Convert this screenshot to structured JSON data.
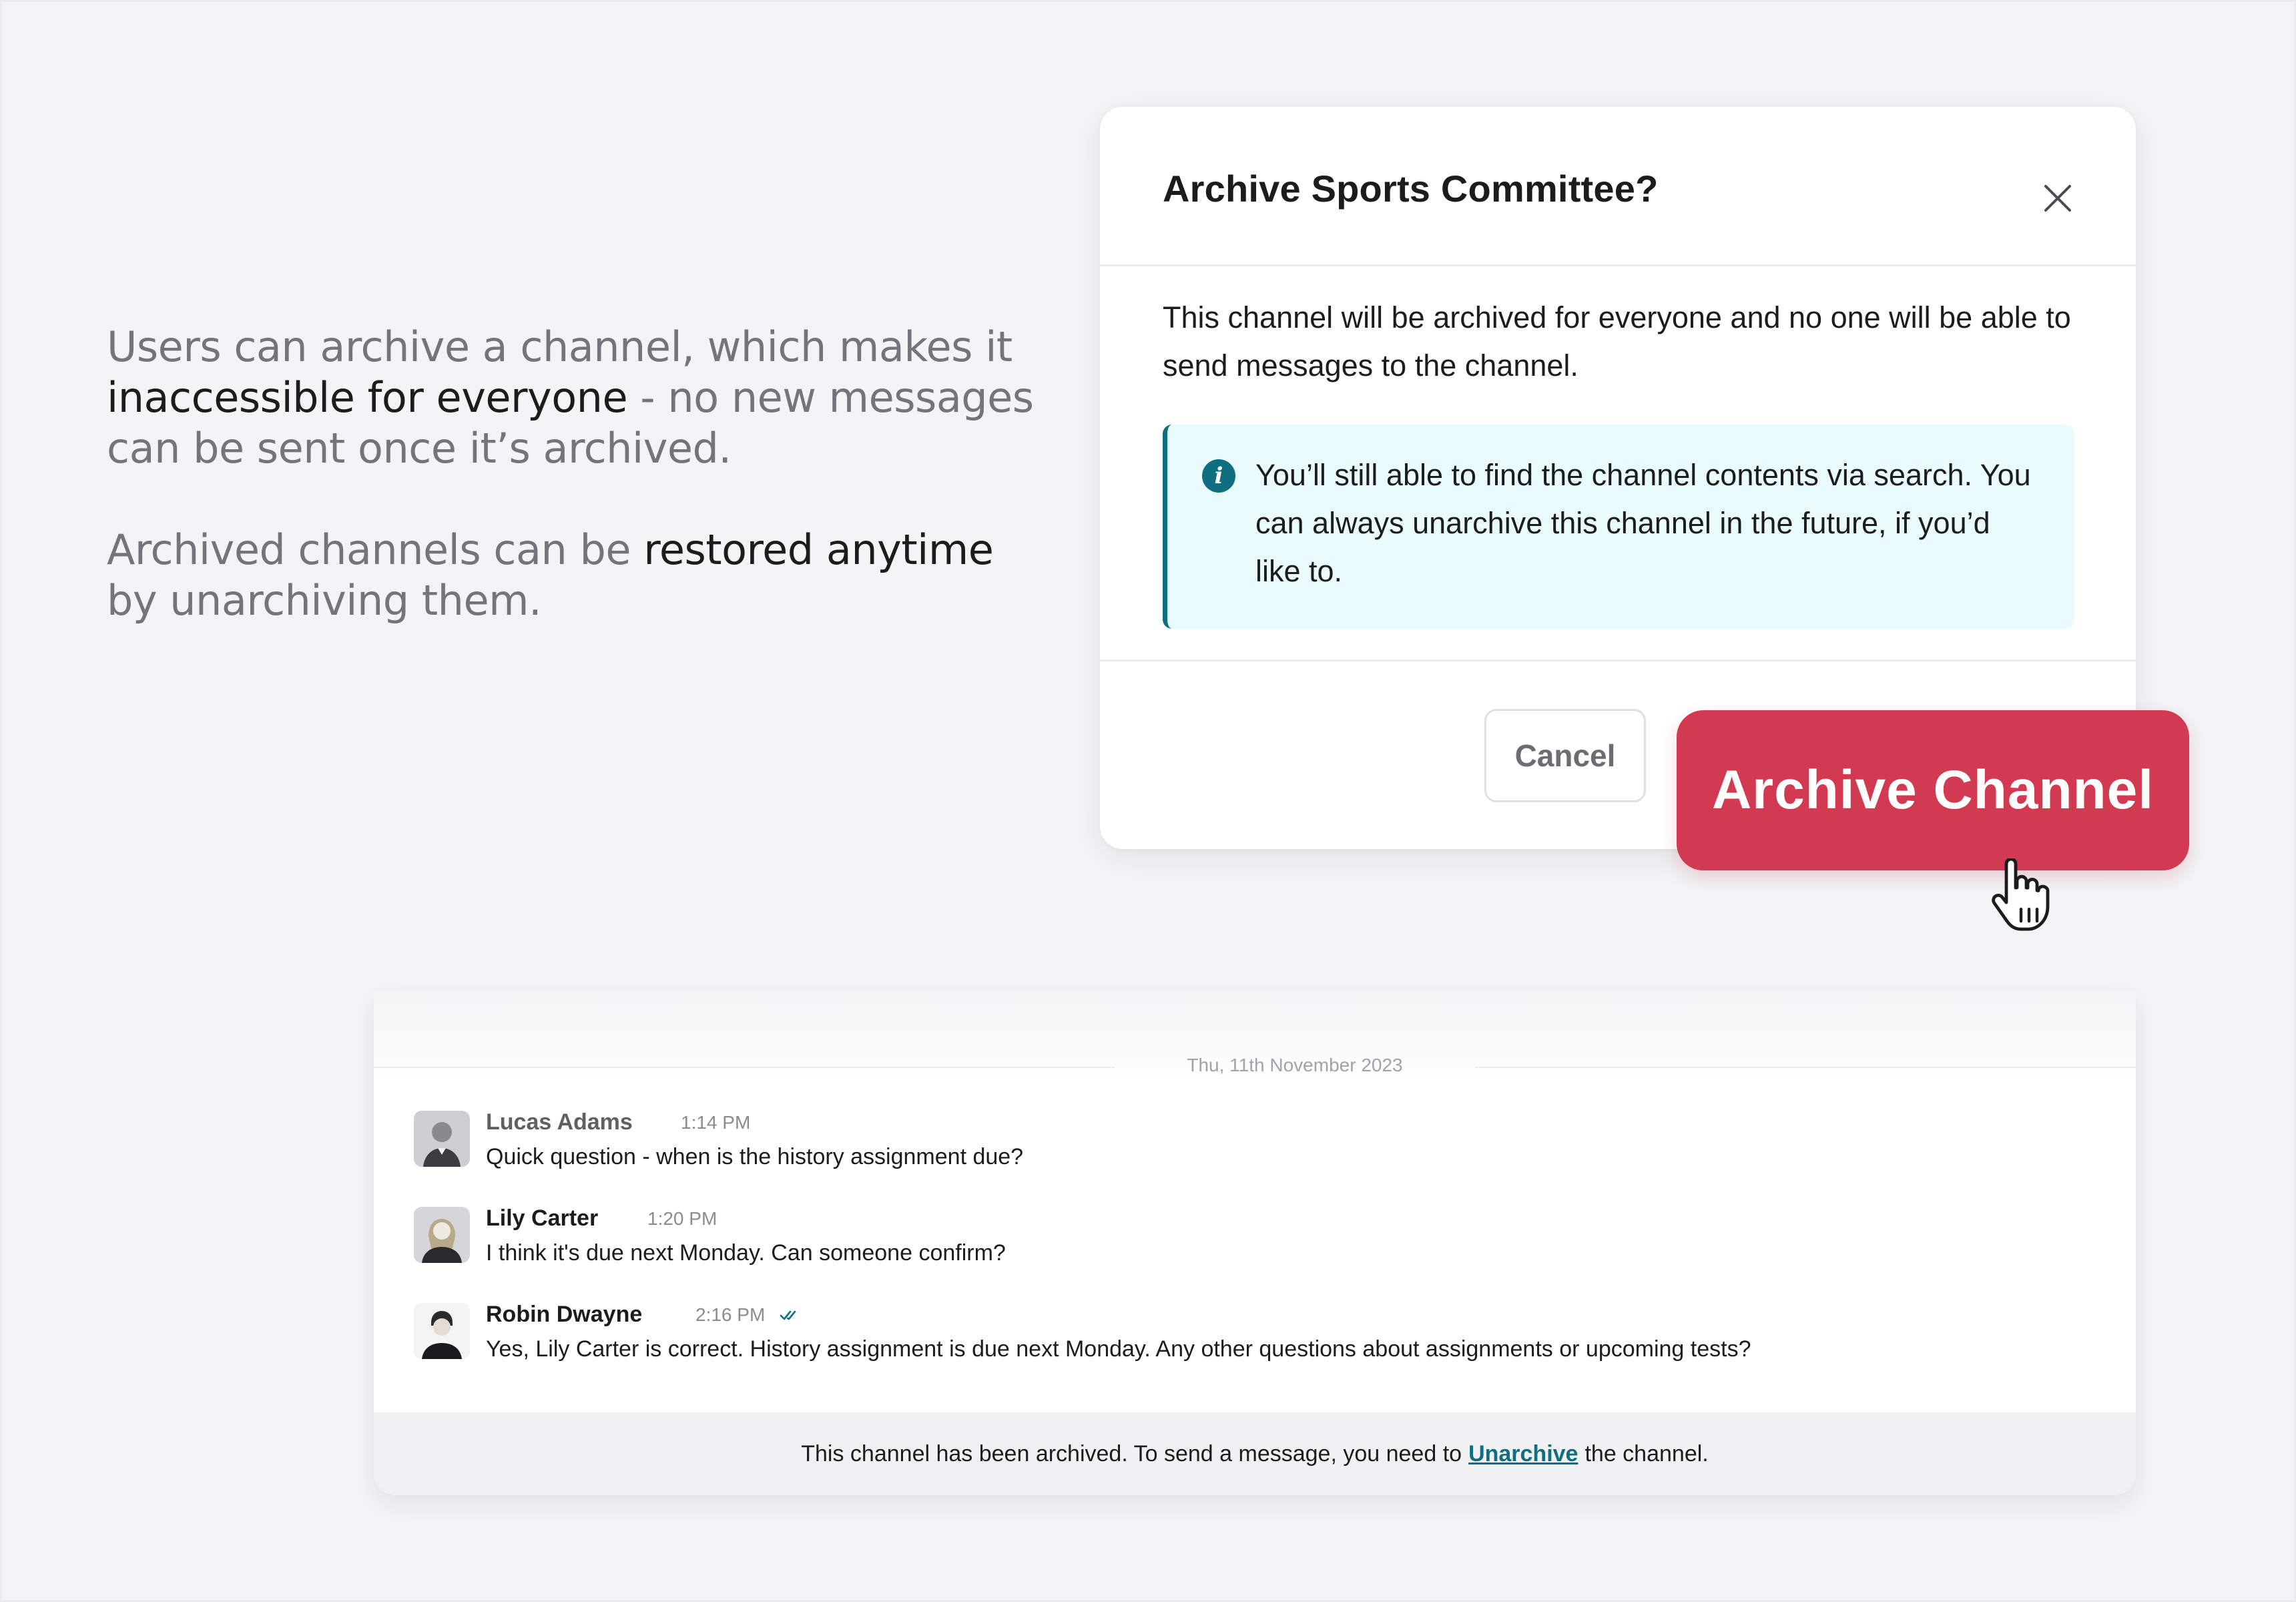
{
  "explainer": {
    "p1_a": "Users can archive a channel, which makes it",
    "p1_strong": "inaccessible for everyone",
    "p1_b": " - no new messages can be sent once it’s archived.",
    "p2_a": "Archived channels can be ",
    "p2_strong": "restored anytime",
    "p2_b": " by unarchiving them."
  },
  "modal": {
    "title": "Archive Sports Committee?",
    "close_icon": "close-icon",
    "description": "This channel will be archived for everyone and no one will be able to send messages to the channel.",
    "info_icon_glyph": "i",
    "info_text": "You’ll still able to find the channel contents via search. You can always unarchive this channel in the future, if you’d like to.",
    "cancel_label": "Cancel",
    "archive_label": "Archive Channel",
    "accent_color": "#d23a52",
    "info_color": "#0f6f80"
  },
  "chat": {
    "date_divider": "Thu, 11th November 2023",
    "messages": [
      {
        "name": "Lucas Adams",
        "time": "1:14 PM",
        "text": "Quick question - when is the history assignment due?"
      },
      {
        "name": "Lily Carter",
        "time": "1:20 PM",
        "text": "I think it's due next Monday. Can someone confirm?"
      },
      {
        "name": "Robin Dwayne",
        "time": "2:16 PM",
        "text": "Yes, Lily Carter is correct. History assignment is due next Monday. Any other questions about assignments or upcoming tests?"
      }
    ],
    "archived_notice_before": "This channel has been archived. To send a message, you need to",
    "archived_notice_link": "Unarchive",
    "archived_notice_after": "the channel."
  }
}
